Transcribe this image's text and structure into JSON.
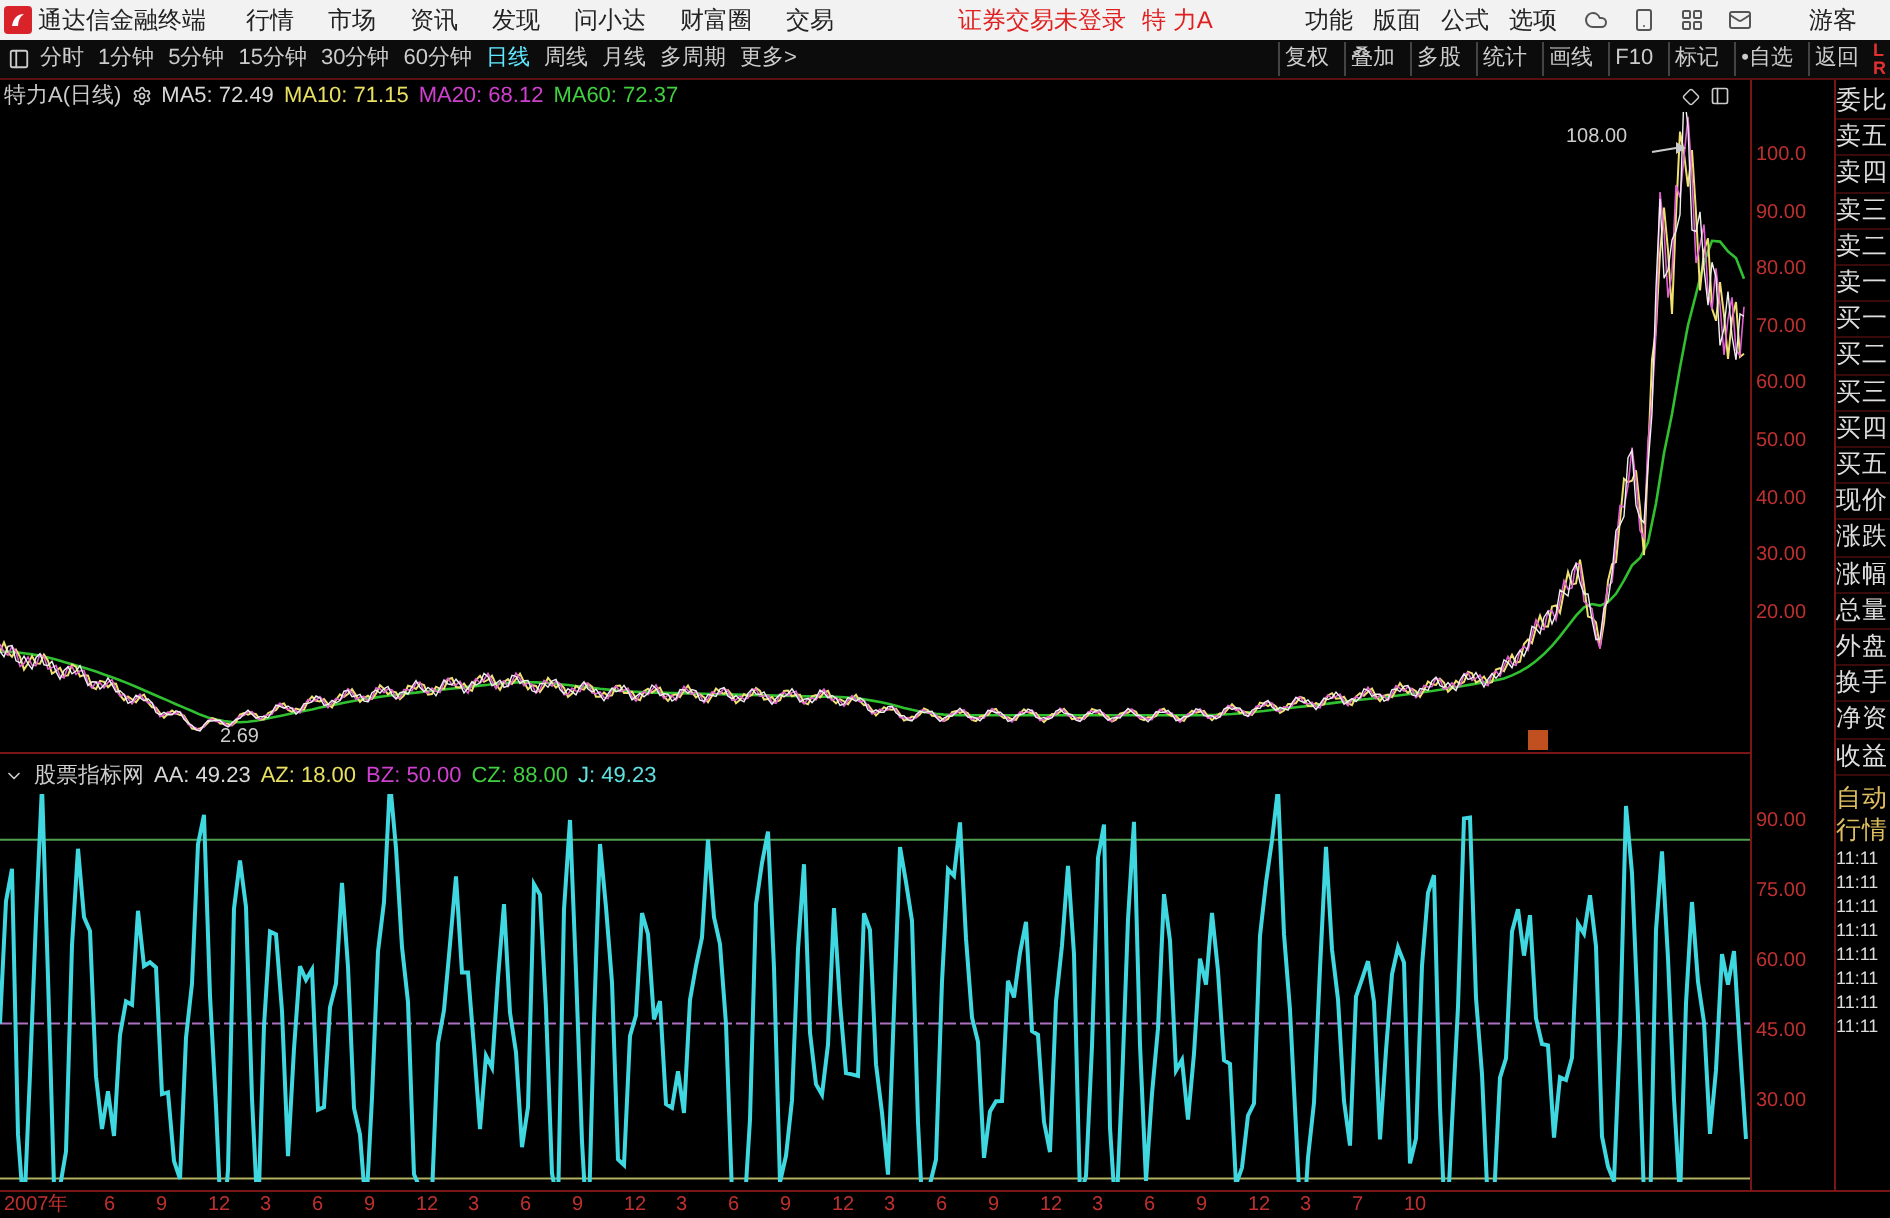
{
  "app_bar": {
    "app_name": "通达信金融终端",
    "menu": [
      "行情",
      "市场",
      "资讯",
      "发现",
      "问小达",
      "财富圈",
      "交易"
    ],
    "login_notice": "证券交易未登录",
    "stock": "特 力A",
    "tools": [
      "功能",
      "版面",
      "公式",
      "选项"
    ],
    "user": "游客"
  },
  "toolbar": {
    "periods": [
      {
        "label": "分时",
        "selected": false
      },
      {
        "label": "1分钟",
        "selected": false
      },
      {
        "label": "5分钟",
        "selected": false
      },
      {
        "label": "15分钟",
        "selected": false
      },
      {
        "label": "30分钟",
        "selected": false
      },
      {
        "label": "60分钟",
        "selected": false
      },
      {
        "label": "日线",
        "selected": true
      },
      {
        "label": "周线",
        "selected": false
      },
      {
        "label": "月线",
        "selected": false
      },
      {
        "label": "多周期",
        "selected": false
      }
    ],
    "more": "更多>",
    "actions": [
      "复权",
      "叠加",
      "多股",
      "统计",
      "画线",
      "F10",
      "标记",
      "•自选",
      "返回"
    ],
    "corner": [
      "L",
      "R"
    ]
  },
  "main_chart": {
    "title": "特力A(日线)",
    "indicators": [
      {
        "label": "MA5: 72.49",
        "color": "#d8d8d8"
      },
      {
        "label": "MA10: 71.15",
        "color": "#e8e060"
      },
      {
        "label": "MA20: 68.12",
        "color": "#d040d0"
      },
      {
        "label": "MA60: 72.37",
        "color": "#40d040"
      }
    ],
    "peak_label": "108.00",
    "low_label": "2.69",
    "y_ticks": [
      "100.0",
      "90.00",
      "80.00",
      "70.00",
      "60.00",
      "50.00",
      "40.00",
      "30.00",
      "20.00"
    ]
  },
  "sub_chart": {
    "title": "股票指标网",
    "indicators": [
      {
        "label": "AA: 49.23",
        "color": "#d8d8d8"
      },
      {
        "label": "AZ: 18.00",
        "color": "#e8e060"
      },
      {
        "label": "BZ: 50.00",
        "color": "#d040d0"
      },
      {
        "label": "CZ: 88.00",
        "color": "#40d040"
      },
      {
        "label": "J: 49.23",
        "color": "#60e0e0"
      }
    ],
    "y_ticks": [
      "90.00",
      "75.00",
      "60.00",
      "45.00",
      "30.00"
    ]
  },
  "x_ticks": [
    "2007年",
    "6",
    "9",
    "12",
    "3",
    "6",
    "9",
    "12",
    "3",
    "6",
    "9",
    "12",
    "3",
    "6",
    "9",
    "12",
    "3",
    "6",
    "9",
    "12",
    "3",
    "6",
    "9",
    "12",
    "3",
    "7",
    "10"
  ],
  "quote_panel": {
    "fields": [
      "委比",
      "卖五",
      "卖四",
      "卖三",
      "卖二",
      "卖一",
      "买一",
      "买二",
      "买三",
      "买四",
      "买五",
      "现价",
      "涨跌",
      "涨幅",
      "总量",
      "外盘",
      "换手",
      "净资",
      "收益"
    ],
    "bottom": [
      "自动",
      "行情"
    ],
    "times": [
      "11:11",
      "11:11",
      "11:11",
      "11:11",
      "11:11",
      "11:11",
      "11:11",
      "11:11"
    ]
  }
}
